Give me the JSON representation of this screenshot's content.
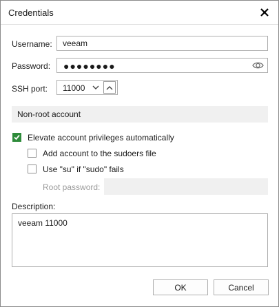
{
  "dialog": {
    "title": "Credentials",
    "close_icon": "close-icon"
  },
  "form": {
    "username_label": "Username:",
    "username_value": "veeam",
    "password_label": "Password:",
    "password_masked": "●●●●●●●●",
    "password_eye_icon": "eye-icon",
    "ssh_port_label": "SSH port:",
    "ssh_port_value": "11000"
  },
  "nonroot": {
    "section_title": "Non-root account",
    "elevate_label": "Elevate account privileges automatically",
    "elevate_checked": true,
    "sudoers_label": "Add account to the sudoers file",
    "sudoers_checked": false,
    "su_label": "Use \"su\" if \"sudo\" fails",
    "su_checked": false,
    "root_password_label": "Root password:",
    "root_password_value": ""
  },
  "description": {
    "label": "Description:",
    "value": "veeam 11000"
  },
  "buttons": {
    "ok": "OK",
    "cancel": "Cancel"
  },
  "colors": {
    "checkbox_checked": "#2e8b3a",
    "section_bg": "#f0f0f0",
    "disabled_text": "#9a9a9a"
  }
}
